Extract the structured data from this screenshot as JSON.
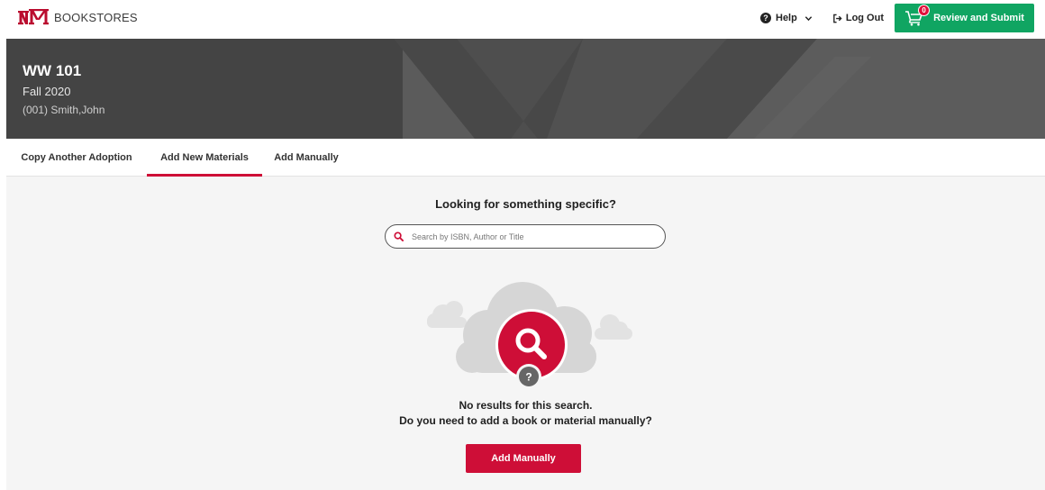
{
  "brand": {
    "text": "BOOKSTORES",
    "logo": "UNM-logo"
  },
  "nav": {
    "help_label": "Help",
    "logout_label": "Log Out",
    "review_label": "Review and Submit",
    "cart_count": "0"
  },
  "course": {
    "code": "WW 101",
    "term": "Fall 2020",
    "section": "(001) Smith,John"
  },
  "tabs": [
    {
      "label": "Copy Another Adoption",
      "active": false
    },
    {
      "label": "Add New Materials",
      "active": true
    },
    {
      "label": "Add Manually",
      "active": false
    }
  ],
  "main": {
    "heading": "Looking for something specific?",
    "search_placeholder": "Search by ISBN, Author or Title",
    "search_value": "",
    "no_results_line1": "No results for this search.",
    "no_results_line2": "Do you need to add a book or material manually?",
    "add_manually_button": "Add Manually"
  },
  "colors": {
    "accent_red": "#ce0e37",
    "submit_green": "#10a562",
    "banner_gray": "#5a5a5a",
    "page_bg": "#f5f5f5"
  }
}
